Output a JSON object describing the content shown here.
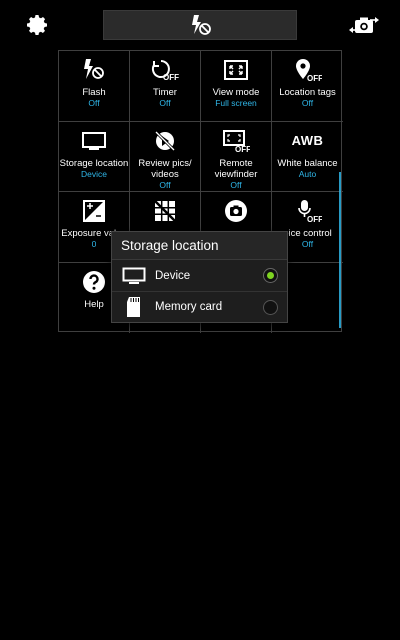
{
  "grid": [
    {
      "icon": "flash-off-icon",
      "label": "Flash",
      "value": "Off"
    },
    {
      "icon": "timer-off-icon",
      "label": "Timer",
      "value": "Off"
    },
    {
      "icon": "view-mode-icon",
      "label": "View mode",
      "value": "Full screen"
    },
    {
      "icon": "location-tags-icon",
      "label": "Location tags",
      "value": "Off"
    },
    {
      "icon": "storage-location-icon",
      "label": "Storage location",
      "value": "Device"
    },
    {
      "icon": "review-pics-icon",
      "label": "Review pics/ videos",
      "value": "Off"
    },
    {
      "icon": "remote-viewfinder-icon",
      "label": "Remote viewfinder",
      "value": "Off"
    },
    {
      "icon": "white-balance-icon",
      "icon_text": "AWB",
      "label": "White balance",
      "value": "Auto"
    },
    {
      "icon": "exposure-value-icon",
      "label": "Exposure value",
      "value": "0"
    },
    {
      "icon": "guidelines-icon",
      "label": "",
      "value": ""
    },
    {
      "icon": "camera-icon",
      "label": "",
      "value": ""
    },
    {
      "icon": "voice-control-icon",
      "label": "oice control",
      "value": "Off"
    },
    {
      "icon": "help-icon",
      "label": "Help",
      "value": ""
    },
    {
      "icon": "",
      "label": "",
      "value": ""
    },
    {
      "icon": "",
      "label": "",
      "value": ""
    },
    {
      "icon": "",
      "label": "",
      "value": ""
    }
  ],
  "popup": {
    "title": "Storage location",
    "options": [
      {
        "icon": "device-icon",
        "label": "Device",
        "selected": true
      },
      {
        "icon": "memory-card-icon",
        "label": "Memory card",
        "selected": false
      }
    ]
  },
  "colors": {
    "accent": "#2fb6e8",
    "radio_selected": "#7ed321"
  }
}
